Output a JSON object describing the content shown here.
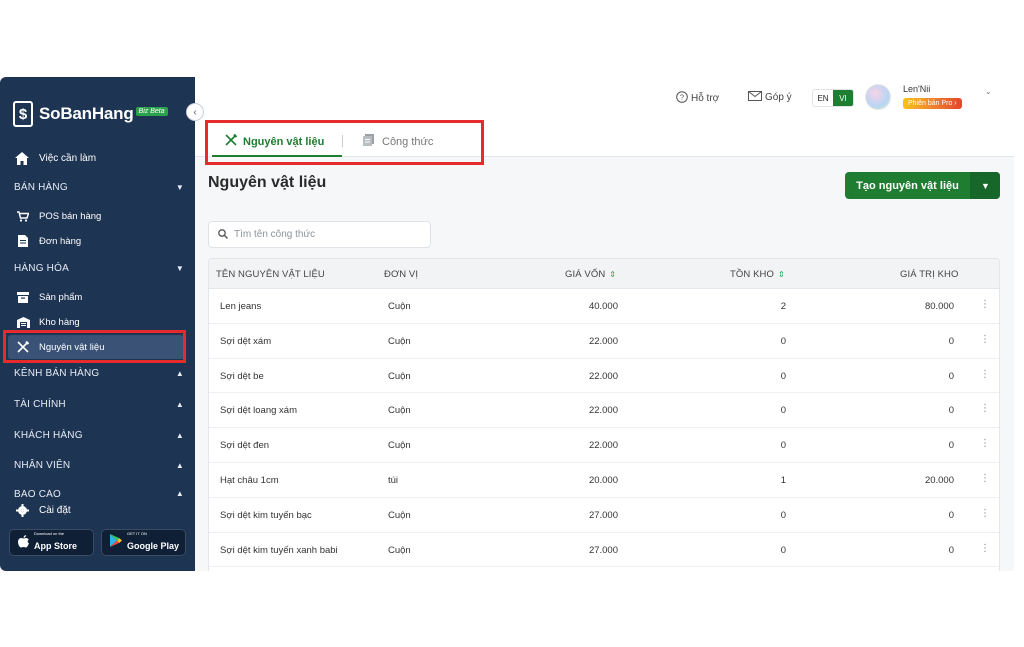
{
  "brand": {
    "name": "SoBanHang",
    "logo_glyph": "$",
    "badge": "Biz Beta"
  },
  "sidebar": {
    "todo": "Việc cần làm",
    "sections": {
      "sales": "BÁN HÀNG",
      "goods": "HÀNG HÓA",
      "channels": "KÊNH BÁN HÀNG",
      "finance": "TÀI CHÍNH",
      "customers": "KHÁCH HÀNG",
      "staff": "NHÂN VIÊN",
      "reports": "BÁO CÁO"
    },
    "sales_items": [
      "POS bán hàng",
      "Đơn hàng"
    ],
    "goods_items": [
      "Sản phẩm",
      "Kho hàng",
      "Nguyên vật liệu"
    ],
    "settings": "Cài đặt",
    "app_store": {
      "small": "Download on the",
      "big": "App Store"
    },
    "google_play": {
      "small": "GET IT ON",
      "big": "Google Play"
    }
  },
  "topbar": {
    "support": "Hỗ trợ",
    "feedback": "Góp ý",
    "lang_en": "EN",
    "lang_vi": "VI",
    "user_name": "Len'Nii",
    "pro_badge": "Phiên bản Pro ›"
  },
  "tabs": {
    "materials": "Nguyên vật liệu",
    "recipes": "Công thức"
  },
  "page": {
    "title": "Nguyên vật liệu",
    "create_button": "Tạo nguyên vật liệu",
    "search_placeholder": "Tìm tên công thức"
  },
  "table": {
    "headers": {
      "name": "TÊN NGUYÊN VẬT LIỆU",
      "unit": "ĐƠN VỊ",
      "cost": "GIÁ VỐN",
      "stock": "TỒN KHO",
      "value": "GIÁ TRỊ KHO"
    },
    "rows": [
      {
        "name": "Len jeans",
        "unit": "Cuộn",
        "cost": "40.000",
        "stock": "2",
        "value": "80.000"
      },
      {
        "name": "Sợi dệt xám",
        "unit": "Cuộn",
        "cost": "22.000",
        "stock": "0",
        "value": "0"
      },
      {
        "name": "Sợi dệt be",
        "unit": "Cuộn",
        "cost": "22.000",
        "stock": "0",
        "value": "0"
      },
      {
        "name": "Sợi dệt loang xám",
        "unit": "Cuộn",
        "cost": "22.000",
        "stock": "0",
        "value": "0"
      },
      {
        "name": "Sợi dệt đen",
        "unit": "Cuộn",
        "cost": "22.000",
        "stock": "0",
        "value": "0"
      },
      {
        "name": "Hạt châu 1cm",
        "unit": "túi",
        "cost": "20.000",
        "stock": "1",
        "value": "20.000"
      },
      {
        "name": "Sợi dệt kim tuyến bạc",
        "unit": "Cuộn",
        "cost": "27.000",
        "stock": "0",
        "value": "0"
      },
      {
        "name": "Sợi dệt kim tuyến xanh babi",
        "unit": "Cuộn",
        "cost": "27.000",
        "stock": "0",
        "value": "0"
      }
    ]
  },
  "colors": {
    "sidebar": "#1e3453",
    "accent": "#1f7d32",
    "highlight": "#e52b2b"
  }
}
